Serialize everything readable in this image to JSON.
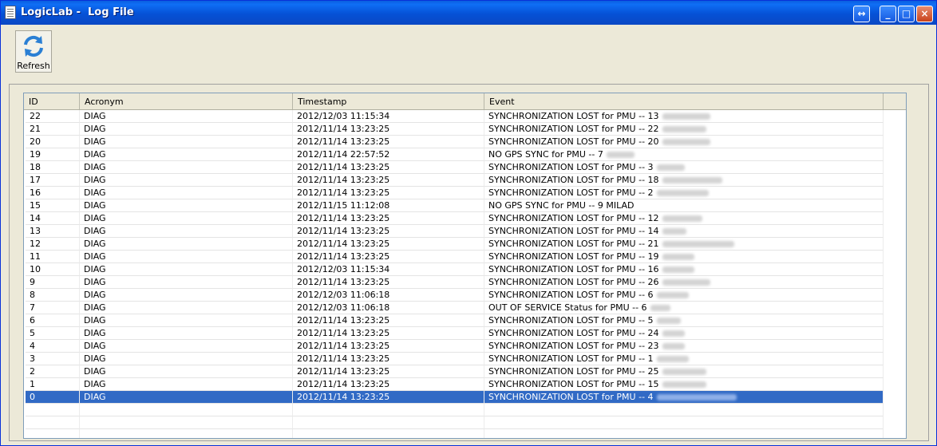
{
  "window": {
    "title": "LogicLab -  Log File",
    "buttons": [
      "↔",
      "_",
      "□",
      "×"
    ]
  },
  "toolbar": {
    "refresh_label": "Refresh"
  },
  "grid": {
    "columns": [
      "ID",
      "Acronym",
      "Timestamp",
      "Event"
    ],
    "rows": [
      {
        "id": "22",
        "acronym": "DIAG",
        "timestamp": "2012/12/03 11:15:34",
        "event": "SYNCHRONIZATION LOST for PMU -- 13",
        "selected": false
      },
      {
        "id": "21",
        "acronym": "DIAG",
        "timestamp": "2012/11/14 13:23:25",
        "event": "SYNCHRONIZATION LOST for PMU -- 22",
        "selected": false
      },
      {
        "id": "20",
        "acronym": "DIAG",
        "timestamp": "2012/11/14 13:23:25",
        "event": "SYNCHRONIZATION LOST for PMU -- 20",
        "selected": false
      },
      {
        "id": "19",
        "acronym": "DIAG",
        "timestamp": "2012/11/14 22:57:52",
        "event": "NO GPS SYNC for PMU -- 7",
        "selected": false
      },
      {
        "id": "18",
        "acronym": "DIAG",
        "timestamp": "2012/11/14 13:23:25",
        "event": "SYNCHRONIZATION LOST for PMU -- 3",
        "selected": false
      },
      {
        "id": "17",
        "acronym": "DIAG",
        "timestamp": "2012/11/14 13:23:25",
        "event": "SYNCHRONIZATION LOST for PMU -- 18",
        "selected": false
      },
      {
        "id": "16",
        "acronym": "DIAG",
        "timestamp": "2012/11/14 13:23:25",
        "event": "SYNCHRONIZATION LOST for PMU -- 2",
        "selected": false
      },
      {
        "id": "15",
        "acronym": "DIAG",
        "timestamp": "2012/11/15 11:12:08",
        "event": "NO GPS SYNC for PMU -- 9 MILAD",
        "selected": false
      },
      {
        "id": "14",
        "acronym": "DIAG",
        "timestamp": "2012/11/14 13:23:25",
        "event": "SYNCHRONIZATION LOST for PMU -- 12",
        "selected": false
      },
      {
        "id": "13",
        "acronym": "DIAG",
        "timestamp": "2012/11/14 13:23:25",
        "event": "SYNCHRONIZATION LOST for PMU -- 14",
        "selected": false
      },
      {
        "id": "12",
        "acronym": "DIAG",
        "timestamp": "2012/11/14 13:23:25",
        "event": "SYNCHRONIZATION LOST for PMU -- 21",
        "selected": false
      },
      {
        "id": "11",
        "acronym": "DIAG",
        "timestamp": "2012/11/14 13:23:25",
        "event": "SYNCHRONIZATION LOST for PMU -- 19",
        "selected": false
      },
      {
        "id": "10",
        "acronym": "DIAG",
        "timestamp": "2012/12/03 11:15:34",
        "event": "SYNCHRONIZATION LOST for PMU -- 16",
        "selected": false
      },
      {
        "id": "9",
        "acronym": "DIAG",
        "timestamp": "2012/11/14 13:23:25",
        "event": "SYNCHRONIZATION LOST for PMU -- 26",
        "selected": false
      },
      {
        "id": "8",
        "acronym": "DIAG",
        "timestamp": "2012/12/03 11:06:18",
        "event": "SYNCHRONIZATION LOST for PMU -- 6",
        "selected": false
      },
      {
        "id": "7",
        "acronym": "DIAG",
        "timestamp": "2012/12/03 11:06:18",
        "event": "OUT OF SERVICE Status for PMU -- 6",
        "selected": false
      },
      {
        "id": "6",
        "acronym": "DIAG",
        "timestamp": "2012/11/14 13:23:25",
        "event": "SYNCHRONIZATION LOST for PMU -- 5",
        "selected": false
      },
      {
        "id": "5",
        "acronym": "DIAG",
        "timestamp": "2012/11/14 13:23:25",
        "event": "SYNCHRONIZATION LOST for PMU -- 24",
        "selected": false
      },
      {
        "id": "4",
        "acronym": "DIAG",
        "timestamp": "2012/11/14 13:23:25",
        "event": "SYNCHRONIZATION LOST for PMU -- 23",
        "selected": false
      },
      {
        "id": "3",
        "acronym": "DIAG",
        "timestamp": "2012/11/14 13:23:25",
        "event": "SYNCHRONIZATION LOST for PMU -- 1",
        "selected": false
      },
      {
        "id": "2",
        "acronym": "DIAG",
        "timestamp": "2012/11/14 13:23:25",
        "event": "SYNCHRONIZATION LOST for PMU -- 25",
        "selected": false
      },
      {
        "id": "1",
        "acronym": "DIAG",
        "timestamp": "2012/11/14 13:23:25",
        "event": "SYNCHRONIZATION LOST for PMU -- 15",
        "selected": false
      },
      {
        "id": "0",
        "acronym": "DIAG",
        "timestamp": "2012/11/14 13:23:25",
        "event": "SYNCHRONIZATION LOST for PMU -- 4",
        "selected": true
      }
    ]
  },
  "colors": {
    "titlebar": "#0551d6",
    "selection": "#316ac5",
    "face": "#ece9d8"
  }
}
